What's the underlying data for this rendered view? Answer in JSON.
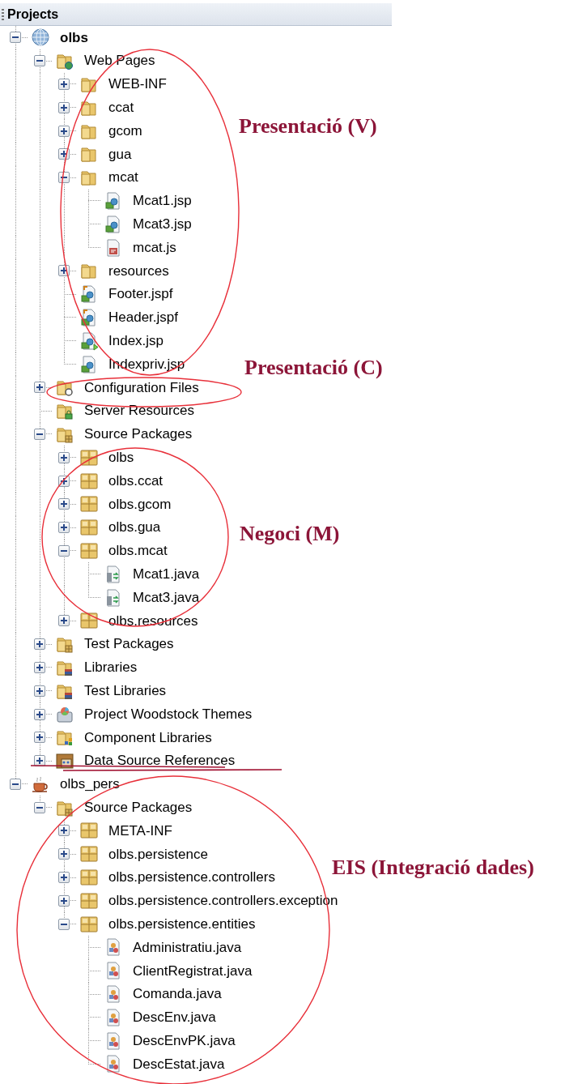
{
  "panel": {
    "title": "Projects"
  },
  "tree": [
    {
      "label": "olbs",
      "kind": "globe",
      "main_project": true,
      "expanded": true,
      "children": [
        {
          "label": "Web Pages",
          "kind": "web-folder",
          "expanded": true,
          "children": [
            {
              "label": "WEB-INF",
              "kind": "folder",
              "expanded": false
            },
            {
              "label": "ccat",
              "kind": "folder",
              "expanded": false
            },
            {
              "label": "gcom",
              "kind": "folder",
              "expanded": false
            },
            {
              "label": "gua",
              "kind": "folder",
              "expanded": false
            },
            {
              "label": "mcat",
              "kind": "folder",
              "expanded": true,
              "children": [
                {
                  "label": "Mcat1.jsp",
                  "kind": "jsp"
                },
                {
                  "label": "Mcat3.jsp",
                  "kind": "jsp"
                },
                {
                  "label": "mcat.js",
                  "kind": "js"
                }
              ]
            },
            {
              "label": "resources",
              "kind": "folder",
              "expanded": false
            },
            {
              "label": "Footer.jspf",
              "kind": "jspf"
            },
            {
              "label": "Header.jspf",
              "kind": "jspf"
            },
            {
              "label": "Index.jsp",
              "kind": "jsp-run"
            },
            {
              "label": "Indexpriv.jsp",
              "kind": "jsp"
            }
          ]
        },
        {
          "label": "Configuration Files",
          "kind": "config-folder",
          "expanded": false
        },
        {
          "label": "Server Resources",
          "kind": "server-folder"
        },
        {
          "label": "Source Packages",
          "kind": "source-folder",
          "expanded": true,
          "children": [
            {
              "label": "olbs",
              "kind": "package",
              "expanded": false
            },
            {
              "label": "olbs.ccat",
              "kind": "package",
              "expanded": false
            },
            {
              "label": "olbs.gcom",
              "kind": "package",
              "expanded": false
            },
            {
              "label": "olbs.gua",
              "kind": "package",
              "expanded": false
            },
            {
              "label": "olbs.mcat",
              "kind": "package",
              "expanded": true,
              "children": [
                {
                  "label": "Mcat1.java",
                  "kind": "java"
                },
                {
                  "label": "Mcat3.java",
                  "kind": "java"
                }
              ]
            },
            {
              "label": "olbs.resources",
              "kind": "package",
              "expanded": false
            }
          ]
        },
        {
          "label": "Test Packages",
          "kind": "source-folder",
          "expanded": false
        },
        {
          "label": "Libraries",
          "kind": "library-folder",
          "expanded": false
        },
        {
          "label": "Test Libraries",
          "kind": "library-folder",
          "expanded": false
        },
        {
          "label": "Project Woodstock Themes",
          "kind": "themes",
          "expanded": false
        },
        {
          "label": "Component Libraries",
          "kind": "component-folder",
          "expanded": false
        },
        {
          "label": "Data Source References",
          "kind": "datasource",
          "expanded": false,
          "struck_out": true
        }
      ]
    },
    {
      "label": "olbs_pers",
      "kind": "coffee",
      "main_project": false,
      "expanded": true,
      "children": [
        {
          "label": "Source Packages",
          "kind": "source-folder",
          "expanded": true,
          "children": [
            {
              "label": "META-INF",
              "kind": "package",
              "expanded": false
            },
            {
              "label": "olbs.persistence",
              "kind": "package",
              "expanded": false
            },
            {
              "label": "olbs.persistence.controllers",
              "kind": "package",
              "expanded": false
            },
            {
              "label": "olbs.persistence.controllers.exception",
              "kind": "package",
              "expanded": false
            },
            {
              "label": "olbs.persistence.entities",
              "kind": "package",
              "expanded": true,
              "children": [
                {
                  "label": "Administratiu.java",
                  "kind": "entity"
                },
                {
                  "label": "ClientRegistrat.java",
                  "kind": "entity"
                },
                {
                  "label": "Comanda.java",
                  "kind": "entity"
                },
                {
                  "label": "DescEnv.java",
                  "kind": "entity"
                },
                {
                  "label": "DescEnvPK.java",
                  "kind": "entity"
                },
                {
                  "label": "DescEstat.java",
                  "kind": "entity"
                }
              ]
            }
          ]
        }
      ]
    }
  ],
  "annotations": [
    {
      "kind": "ellipse"
    },
    {
      "kind": "label",
      "text": "Presentació (V)"
    },
    {
      "kind": "ellipse"
    },
    {
      "kind": "label",
      "text": "Presentació (C)"
    },
    {
      "kind": "ellipse"
    },
    {
      "kind": "label",
      "text": "Negoci (M)"
    },
    {
      "kind": "ellipse"
    },
    {
      "kind": "label",
      "text": "EIS (Integració dades)"
    }
  ]
}
